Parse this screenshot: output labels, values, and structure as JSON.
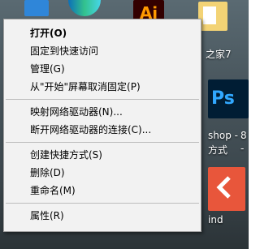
{
  "colors": {
    "menu_background": "#f2f2f2",
    "menu_border": "#a0a0a0",
    "separator": "#bdbdbd"
  },
  "desktop": {
    "icons": [
      {
        "name": "blue-app-icon"
      },
      {
        "name": "edge-icon"
      },
      {
        "name": "illustrator-icon",
        "text": "Ai"
      },
      {
        "name": "folder-icon"
      },
      {
        "name": "photoshop-icon",
        "text": "Ps"
      },
      {
        "name": "red-app-icon"
      }
    ],
    "labels": {
      "label_1": "之家7",
      "label_2": "shop -",
      "label_3": "方式",
      "label_4": "ind",
      "label_5": "8",
      "label_6": "-"
    }
  },
  "context_menu": {
    "groups": [
      [
        {
          "label": "打开(O)",
          "bold": true
        },
        {
          "label": "固定到快速访问"
        },
        {
          "label": "管理(G)"
        },
        {
          "label": "从\"开始\"屏幕取消固定(P)"
        }
      ],
      [
        {
          "label": "映射网络驱动器(N)..."
        },
        {
          "label": "断开网络驱动器的连接(C)..."
        }
      ],
      [
        {
          "label": "创建快捷方式(S)"
        },
        {
          "label": "删除(D)"
        },
        {
          "label": "重命名(M)"
        }
      ],
      [
        {
          "label": "属性(R)"
        }
      ]
    ]
  }
}
